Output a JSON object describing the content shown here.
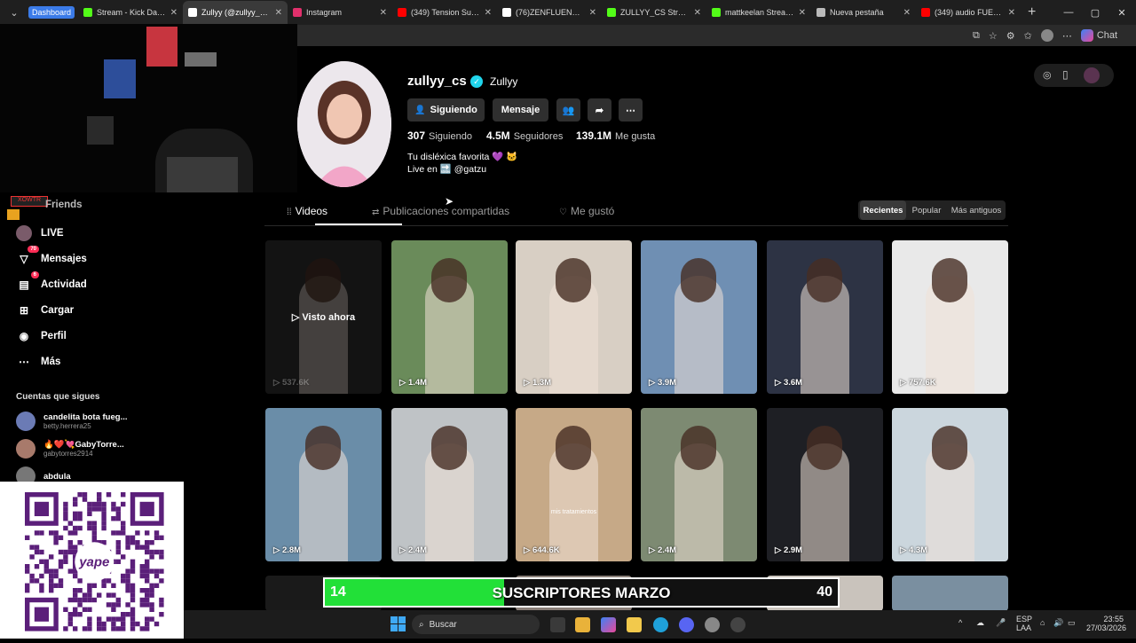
{
  "browser": {
    "tab_group_label": "Dashboard",
    "tabs": [
      {
        "label": "Stream - Kick Dashboard",
        "icon": "kick-icon",
        "color": "#53fc18"
      },
      {
        "label": "Zullyy (@zullyy_cs) | TikTok",
        "icon": "tiktok-icon",
        "color": "#ffffff",
        "active": true
      },
      {
        "label": "Instagram",
        "icon": "instagram-icon",
        "color": "#e1306c"
      },
      {
        "label": "(349) Tension Suspense",
        "icon": "youtube-icon",
        "color": "#ff0000"
      },
      {
        "label": "(76)ZENFLUENCER (@",
        "icon": "tiktok-icon",
        "color": "#ffffff"
      },
      {
        "label": "ZULLYY_CS Stream - Kick",
        "icon": "kick-icon",
        "color": "#53fc18"
      },
      {
        "label": "mattkeelan Stream - Kick",
        "icon": "kick-icon",
        "color": "#53fc18"
      },
      {
        "label": "Nueva pestaña",
        "icon": "page-icon",
        "color": "#bbbbbb"
      },
      {
        "label": "(349) audio FUEGO, FUEGO",
        "icon": "youtube-icon",
        "color": "#ff0000"
      }
    ],
    "chat_label": "Chat"
  },
  "sidebar": {
    "friends_label": "Friends",
    "items": [
      {
        "label": "LIVE",
        "icon": "live-icon"
      },
      {
        "label": "Mensajes",
        "icon": "messages-icon",
        "badge": "70"
      },
      {
        "label": "Actividad",
        "icon": "activity-icon",
        "badge": "6"
      },
      {
        "label": "Cargar",
        "icon": "upload-icon"
      },
      {
        "label": "Perfil",
        "icon": "profile-icon"
      },
      {
        "label": "Más",
        "icon": "more-icon"
      }
    ],
    "following_header": "Cuentas que sigues",
    "following": [
      {
        "name": "candelita bota fueg...",
        "user": "betty.herrera25"
      },
      {
        "name": "🔥❤️💘GabyTorre...",
        "user": "gabytorres2914"
      },
      {
        "name": "abdula",
        "user": ""
      }
    ]
  },
  "qr": {
    "brand": "yape"
  },
  "profile": {
    "username": "zullyy_cs",
    "display_name": "Zullyy",
    "buttons": {
      "following": "Siguiendo",
      "message": "Mensaje"
    },
    "stats": {
      "following_count": "307",
      "following_label": "Siguiendo",
      "followers_count": "4.5M",
      "followers_label": "Seguidores",
      "likes_count": "139.1M",
      "likes_label": "Me gusta"
    },
    "bio_line1": "Tu disléxica favorita 💜 🐱",
    "bio_line2": "Live en 🔜 @gatzu"
  },
  "content_tabs": {
    "videos": "Videos",
    "reposts": "Publicaciones compartidas",
    "liked": "Me gustó"
  },
  "sort": {
    "recent": "Recientes",
    "popular": "Popular",
    "oldest": "Más antiguos"
  },
  "videos": [
    {
      "views": "537.6K",
      "overlay": "Visto ahora",
      "bg": "#2a2a2a"
    },
    {
      "views": "1.4M",
      "bg": "#6a8b5a"
    },
    {
      "views": "1.3M",
      "bg": "#d8cfc4"
    },
    {
      "views": "3.9M",
      "bg": "#6f8fb3"
    },
    {
      "views": "3.6M",
      "bg": "#2d3344"
    },
    {
      "views": "757.6K",
      "bg": "#e9e9e9"
    },
    {
      "views": "2.8M",
      "bg": "#6a8da8"
    },
    {
      "views": "2.4M",
      "bg": "#bfc3c6"
    },
    {
      "views": "644.6K",
      "bg": "#c6a987",
      "caption": "mis tratamientos"
    },
    {
      "views": "2.4M",
      "bg": "#7d8a72"
    },
    {
      "views": "2.9M",
      "bg": "#1e1f24"
    },
    {
      "views": "4.3M",
      "bg": "#cbd6dd"
    }
  ],
  "sub_goal": {
    "title": "SUSCRIPTORES MARZO",
    "current": "14",
    "goal": "40",
    "fill_fraction": 0.35
  },
  "taskbar": {
    "search_placeholder": "Buscar",
    "lang_top": "ESP",
    "lang_bottom": "LAA",
    "time": "23:55",
    "date": "27/03/2026"
  }
}
